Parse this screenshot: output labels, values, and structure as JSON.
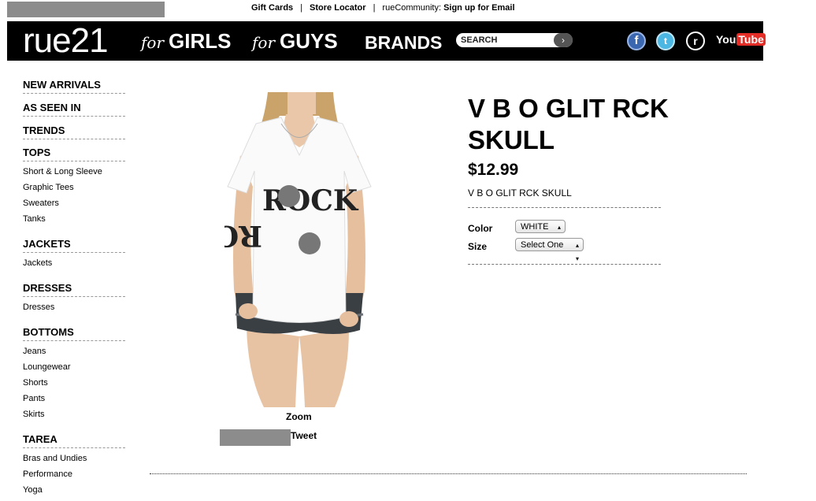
{
  "top_links": {
    "gift_cards": "Gift Cards",
    "sep1": "|",
    "store_locator": "Store Locator",
    "sep2": "|",
    "community": "rueCommunity:",
    "signup": "Sign up for Email"
  },
  "nav": {
    "logo": "rue21",
    "for_label": "for",
    "girls": "GIRLS",
    "guys": "GUYS",
    "brands": "BRANDS",
    "search_placeholder": "SEARCH",
    "search_go": "›",
    "social": {
      "facebook": "f",
      "twitter": "t",
      "rue": "r",
      "youtube_you": "You",
      "youtube_tube": "Tube"
    }
  },
  "sidebar": {
    "new_arrivals": "NEW ARRIVALS",
    "as_seen_in": "AS SEEN IN",
    "trends": "TRENDS",
    "tops": "TOPS",
    "tops_items": [
      "Short & Long Sleeve",
      "Graphic Tees",
      "Sweaters",
      "Tanks"
    ],
    "jackets": "JACKETS",
    "jackets_items": [
      "Jackets"
    ],
    "dresses": "DRESSES",
    "dresses_items": [
      "Dresses"
    ],
    "bottoms": "BOTTOMS",
    "bottoms_items": [
      "Jeans",
      "Loungewear",
      "Shorts",
      "Pants",
      "Skirts"
    ],
    "tarea": "TAREA",
    "tarea_items": [
      "Bras and Undies",
      "Performance",
      "Yoga"
    ]
  },
  "product": {
    "title": "V B O GLIT RCK SKULL",
    "price": "$12.99",
    "subtitle": "V B O GLIT RCK SKULL",
    "color_label": "Color",
    "color_value": "WHITE",
    "size_label": "Size",
    "size_value": "Select One",
    "zoom": "Zoom",
    "tweet": "Tweet",
    "graphic_text": "ROCK"
  }
}
